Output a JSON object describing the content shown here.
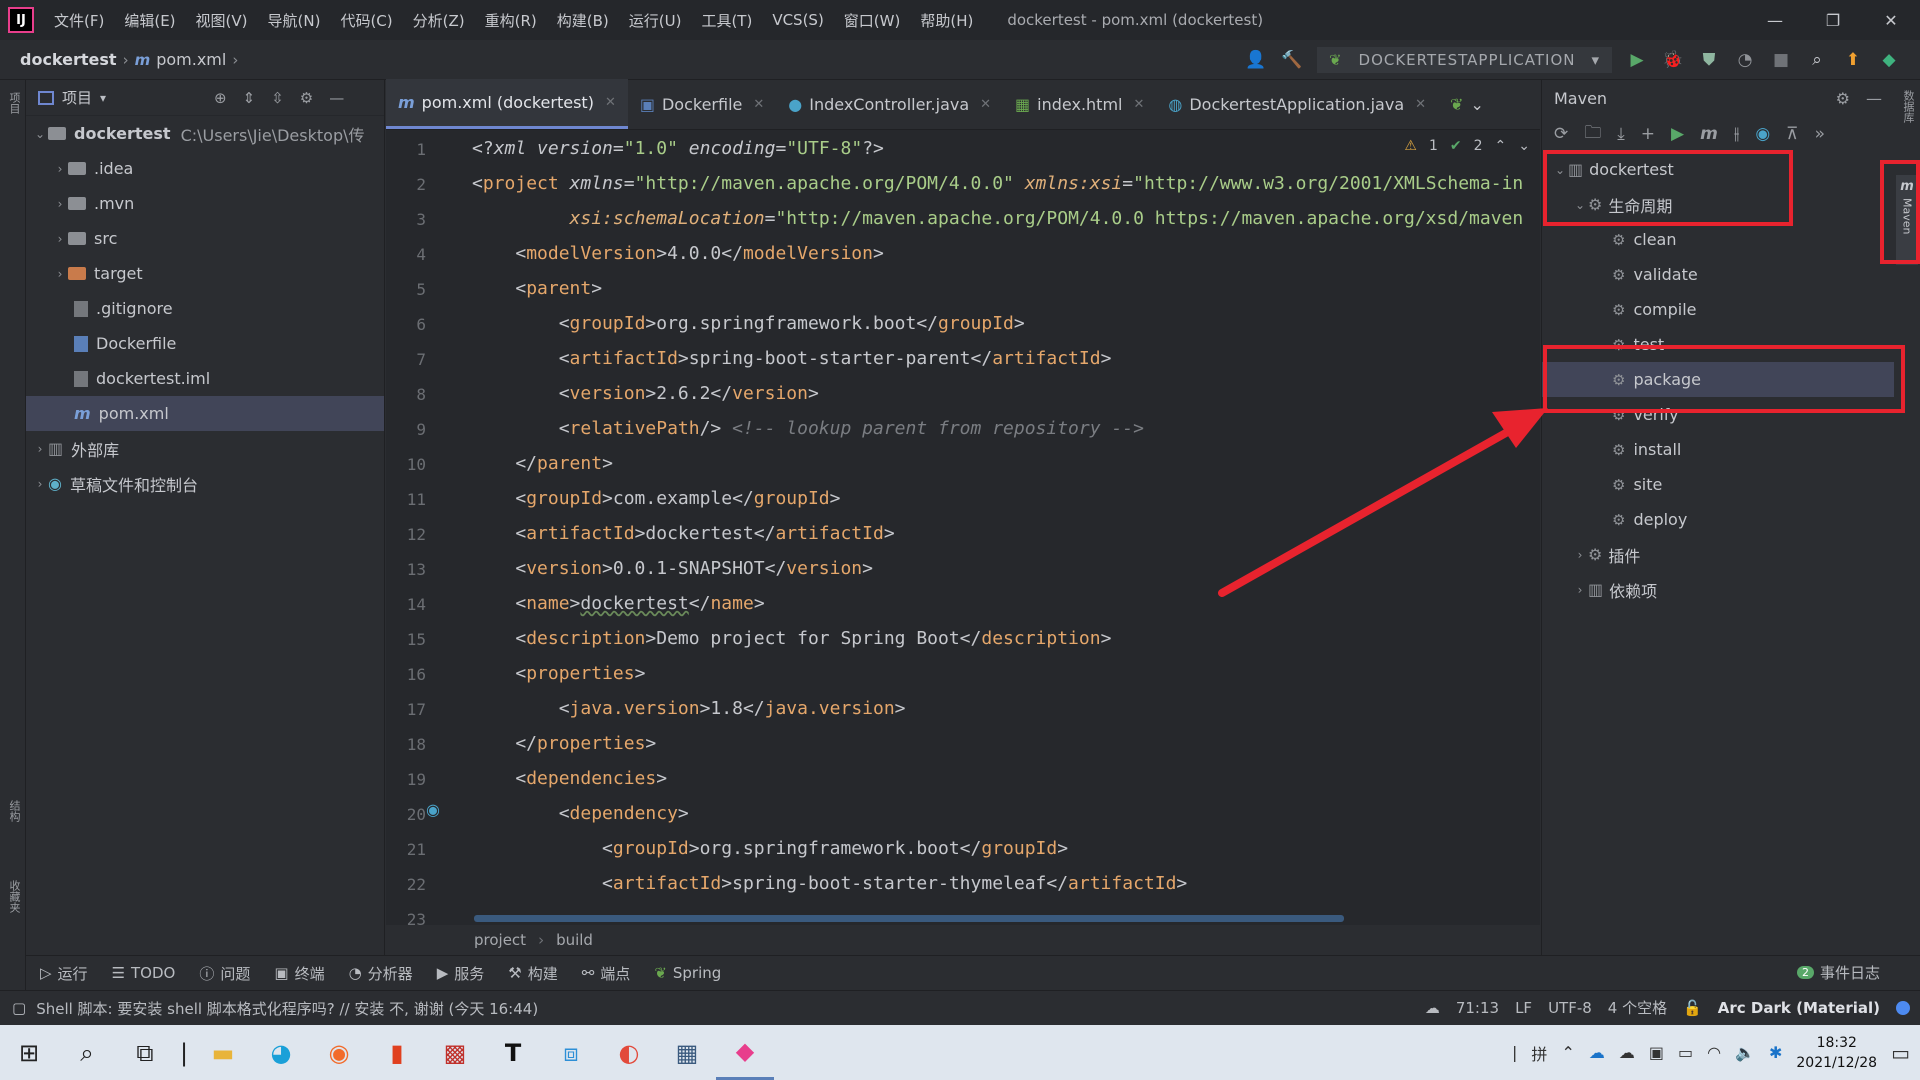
{
  "menubar": {
    "logo": "IJ",
    "items": [
      "文件(F)",
      "编辑(E)",
      "视图(V)",
      "导航(N)",
      "代码(C)",
      "分析(Z)",
      "重构(R)",
      "构建(B)",
      "运行(U)",
      "工具(T)",
      "VCS(S)",
      "窗口(W)",
      "帮助(H)"
    ],
    "title": "dockertest - pom.xml (dockertest)"
  },
  "navbar": {
    "project": "dockertest",
    "file": "pom.xml",
    "run_config": "DOCKERTESTAPPLICATION"
  },
  "project_panel": {
    "title": "项目",
    "root": {
      "name": "dockertest",
      "path": "C:\\Users\\Jie\\Desktop\\传"
    },
    "items": [
      {
        "name": ".idea",
        "kind": "folder"
      },
      {
        "name": ".mvn",
        "kind": "folder"
      },
      {
        "name": "src",
        "kind": "folder"
      },
      {
        "name": "target",
        "kind": "folder-excluded"
      },
      {
        "name": ".gitignore",
        "kind": "file"
      },
      {
        "name": "Dockerfile",
        "kind": "file"
      },
      {
        "name": "dockertest.iml",
        "kind": "file"
      },
      {
        "name": "pom.xml",
        "kind": "maven-file",
        "selected": true
      }
    ],
    "external_libs": "外部库",
    "scratches": "草稿文件和控制台"
  },
  "tabs": [
    {
      "label": "pom.xml (dockertest)",
      "active": true
    },
    {
      "label": "Dockerfile"
    },
    {
      "label": "IndexController.java"
    },
    {
      "label": "index.html"
    },
    {
      "label": "DockertestApplication.java"
    }
  ],
  "editor": {
    "inspection_warnings": "1",
    "inspection_ok": "2",
    "line_numbers": [
      "1",
      "2",
      "3",
      "4",
      "5",
      "6",
      "7",
      "8",
      "9",
      "10",
      "11",
      "12",
      "13",
      "14",
      "15",
      "16",
      "17",
      "18",
      "19",
      "20",
      "21",
      "22",
      "23"
    ],
    "breadcrumb": [
      "project",
      "build"
    ]
  },
  "maven": {
    "title": "Maven",
    "root": "dockertest",
    "lifecycle": "生命周期",
    "goals": [
      "clean",
      "validate",
      "compile",
      "test",
      "package",
      "verify",
      "install",
      "site",
      "deploy"
    ],
    "selected_goal": "package",
    "plugins": "插件",
    "dependencies": "依赖项",
    "side_tab": "Maven"
  },
  "bottom_tools": [
    "运行",
    "TODO",
    "问题",
    "终端",
    "分析器",
    "服务",
    "构建",
    "端点",
    "Spring"
  ],
  "event_log": {
    "count": "2",
    "label": "事件日志"
  },
  "statusbar": {
    "message": "Shell 脚本: 要安装 shell 脚本格式化程序吗? // 安装    不, 谢谢 (今天 16:44)",
    "position": "71:13",
    "line_sep": "LF",
    "encoding": "UTF-8",
    "indent": "4 个空格",
    "theme": "Arc Dark (Material)"
  },
  "taskbar": {
    "ime": "拼",
    "time": "18:32",
    "date": "2021/12/28"
  },
  "left_stripe": {
    "top": "项目",
    "structure": "结构",
    "favorites": "收藏夹"
  },
  "right_stripe": {
    "db": "数据库"
  },
  "colors": {
    "annotation": "#e8232e",
    "selection": "#414558",
    "tag": "#e5a76b",
    "string": "#a9cd89"
  }
}
